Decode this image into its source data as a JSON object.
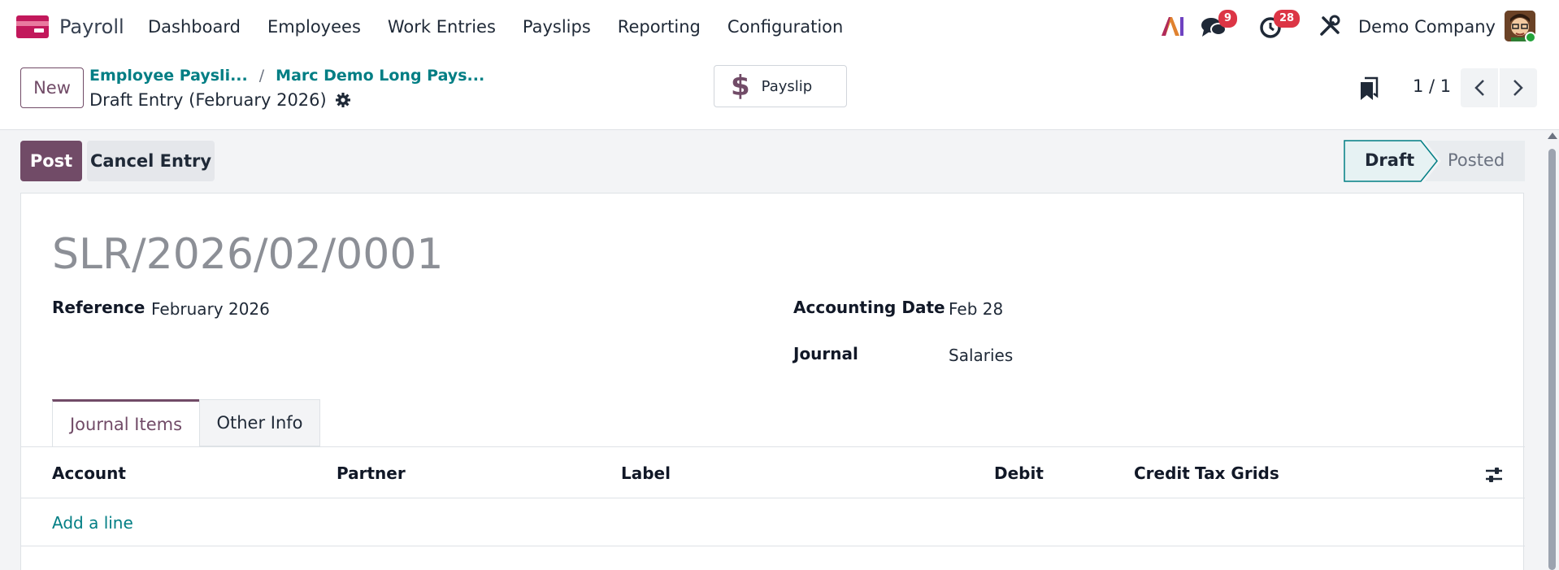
{
  "navbar": {
    "app_name": "Payroll",
    "menu": [
      "Dashboard",
      "Employees",
      "Work Entries",
      "Payslips",
      "Reporting",
      "Configuration"
    ],
    "chat_badge": "9",
    "activity_badge": "28",
    "company": "Demo Company"
  },
  "control": {
    "new_label": "New",
    "breadcrumb": [
      "Employee Paysli...",
      "Marc Demo Long Pays..."
    ],
    "breadcrumb_sep": "/",
    "record_title": "Draft Entry (February 2026)",
    "smart_button": "Payslip",
    "pager": "1 / 1"
  },
  "statusbar": {
    "post_label": "Post",
    "cancel_label": "Cancel Entry",
    "states": [
      "Draft",
      "Posted"
    ],
    "active_state": "Draft"
  },
  "form": {
    "name": "SLR/2026/02/0001",
    "reference_label": "Reference",
    "reference_value": "February 2026",
    "accounting_date_label": "Accounting Date",
    "accounting_date_value": "Feb 28",
    "journal_label": "Journal",
    "journal_value": "Salaries"
  },
  "tabs": [
    "Journal Items",
    "Other Info"
  ],
  "table": {
    "columns": [
      "Account",
      "Partner",
      "Label",
      "Debit",
      "Credit",
      "Tax Grids"
    ],
    "add_line": "Add a line"
  },
  "colors": {
    "brand": "#714b67",
    "link": "#017e84",
    "badge": "#dc3545"
  }
}
